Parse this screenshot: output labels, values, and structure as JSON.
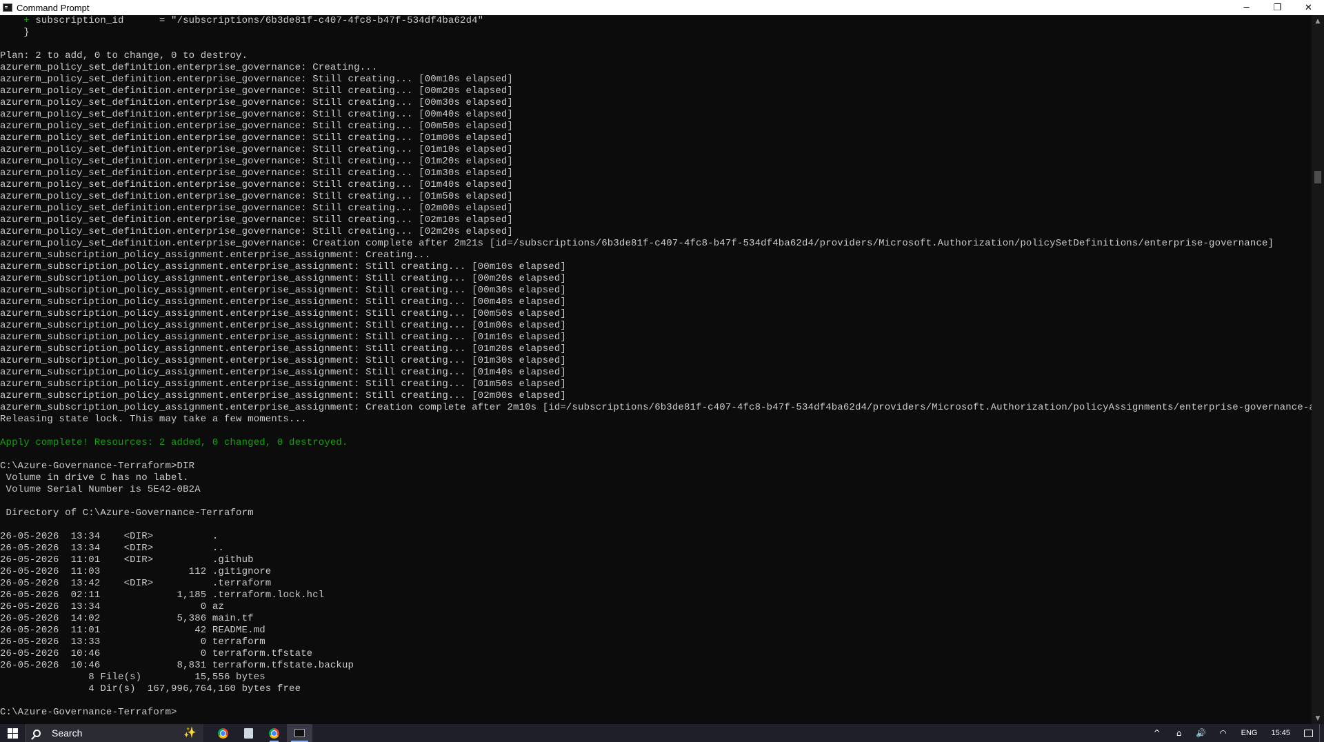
{
  "window": {
    "title": "Command Prompt",
    "minimize_glyph": "─",
    "maximize_glyph": "❐",
    "close_glyph": "✕"
  },
  "console": {
    "lines": [
      {
        "text": "    + subscription_id      = \"/subscriptions/6b3de81f-c407-4fc8-b47f-534df4ba62d4\"",
        "color": "plus"
      },
      {
        "text": "    }",
        "color": "default"
      },
      {
        "text": "",
        "color": "default"
      },
      {
        "text": "Plan: 2 to add, 0 to change, 0 to destroy.",
        "color": "default"
      },
      {
        "text": "azurerm_policy_set_definition.enterprise_governance: Creating...",
        "color": "default"
      },
      {
        "text": "azurerm_policy_set_definition.enterprise_governance: Still creating... [00m10s elapsed]",
        "color": "default"
      },
      {
        "text": "azurerm_policy_set_definition.enterprise_governance: Still creating... [00m20s elapsed]",
        "color": "default"
      },
      {
        "text": "azurerm_policy_set_definition.enterprise_governance: Still creating... [00m30s elapsed]",
        "color": "default"
      },
      {
        "text": "azurerm_policy_set_definition.enterprise_governance: Still creating... [00m40s elapsed]",
        "color": "default"
      },
      {
        "text": "azurerm_policy_set_definition.enterprise_governance: Still creating... [00m50s elapsed]",
        "color": "default"
      },
      {
        "text": "azurerm_policy_set_definition.enterprise_governance: Still creating... [01m00s elapsed]",
        "color": "default"
      },
      {
        "text": "azurerm_policy_set_definition.enterprise_governance: Still creating... [01m10s elapsed]",
        "color": "default"
      },
      {
        "text": "azurerm_policy_set_definition.enterprise_governance: Still creating... [01m20s elapsed]",
        "color": "default"
      },
      {
        "text": "azurerm_policy_set_definition.enterprise_governance: Still creating... [01m30s elapsed]",
        "color": "default"
      },
      {
        "text": "azurerm_policy_set_definition.enterprise_governance: Still creating... [01m40s elapsed]",
        "color": "default"
      },
      {
        "text": "azurerm_policy_set_definition.enterprise_governance: Still creating... [01m50s elapsed]",
        "color": "default"
      },
      {
        "text": "azurerm_policy_set_definition.enterprise_governance: Still creating... [02m00s elapsed]",
        "color": "default"
      },
      {
        "text": "azurerm_policy_set_definition.enterprise_governance: Still creating... [02m10s elapsed]",
        "color": "default"
      },
      {
        "text": "azurerm_policy_set_definition.enterprise_governance: Still creating... [02m20s elapsed]",
        "color": "default"
      },
      {
        "text": "azurerm_policy_set_definition.enterprise_governance: Creation complete after 2m21s [id=/subscriptions/6b3de81f-c407-4fc8-b47f-534df4ba62d4/providers/Microsoft.Authorization/policySetDefinitions/enterprise-governance]",
        "color": "default"
      },
      {
        "text": "azurerm_subscription_policy_assignment.enterprise_assignment: Creating...",
        "color": "default"
      },
      {
        "text": "azurerm_subscription_policy_assignment.enterprise_assignment: Still creating... [00m10s elapsed]",
        "color": "default"
      },
      {
        "text": "azurerm_subscription_policy_assignment.enterprise_assignment: Still creating... [00m20s elapsed]",
        "color": "default"
      },
      {
        "text": "azurerm_subscription_policy_assignment.enterprise_assignment: Still creating... [00m30s elapsed]",
        "color": "default"
      },
      {
        "text": "azurerm_subscription_policy_assignment.enterprise_assignment: Still creating... [00m40s elapsed]",
        "color": "default"
      },
      {
        "text": "azurerm_subscription_policy_assignment.enterprise_assignment: Still creating... [00m50s elapsed]",
        "color": "default"
      },
      {
        "text": "azurerm_subscription_policy_assignment.enterprise_assignment: Still creating... [01m00s elapsed]",
        "color": "default"
      },
      {
        "text": "azurerm_subscription_policy_assignment.enterprise_assignment: Still creating... [01m10s elapsed]",
        "color": "default"
      },
      {
        "text": "azurerm_subscription_policy_assignment.enterprise_assignment: Still creating... [01m20s elapsed]",
        "color": "default"
      },
      {
        "text": "azurerm_subscription_policy_assignment.enterprise_assignment: Still creating... [01m30s elapsed]",
        "color": "default"
      },
      {
        "text": "azurerm_subscription_policy_assignment.enterprise_assignment: Still creating... [01m40s elapsed]",
        "color": "default"
      },
      {
        "text": "azurerm_subscription_policy_assignment.enterprise_assignment: Still creating... [01m50s elapsed]",
        "color": "default"
      },
      {
        "text": "azurerm_subscription_policy_assignment.enterprise_assignment: Still creating... [02m00s elapsed]",
        "color": "default"
      },
      {
        "text": "azurerm_subscription_policy_assignment.enterprise_assignment: Creation complete after 2m10s [id=/subscriptions/6b3de81f-c407-4fc8-b47f-534df4ba62d4/providers/Microsoft.Authorization/policyAssignments/enterprise-governance-assignment]",
        "color": "default"
      },
      {
        "text": "Releasing state lock. This may take a few moments...",
        "color": "default"
      },
      {
        "text": "",
        "color": "default"
      },
      {
        "text": "Apply complete! Resources: 2 added, 0 changed, 0 destroyed.",
        "color": "green"
      },
      {
        "text": "",
        "color": "default"
      },
      {
        "text": "C:\\Azure-Governance-Terraform>DIR",
        "color": "default"
      },
      {
        "text": " Volume in drive C has no label.",
        "color": "default"
      },
      {
        "text": " Volume Serial Number is 5E42-0B2A",
        "color": "default"
      },
      {
        "text": "",
        "color": "default"
      },
      {
        "text": " Directory of C:\\Azure-Governance-Terraform",
        "color": "default"
      },
      {
        "text": "",
        "color": "default"
      },
      {
        "text": "26-05-2026  13:34    <DIR>          .",
        "color": "default"
      },
      {
        "text": "26-05-2026  13:34    <DIR>          ..",
        "color": "default"
      },
      {
        "text": "26-05-2026  11:01    <DIR>          .github",
        "color": "default"
      },
      {
        "text": "26-05-2026  11:03               112 .gitignore",
        "color": "default"
      },
      {
        "text": "26-05-2026  13:42    <DIR>          .terraform",
        "color": "default"
      },
      {
        "text": "26-05-2026  02:11             1,185 .terraform.lock.hcl",
        "color": "default"
      },
      {
        "text": "26-05-2026  13:34                 0 az",
        "color": "default"
      },
      {
        "text": "26-05-2026  14:02             5,386 main.tf",
        "color": "default"
      },
      {
        "text": "26-05-2026  11:01                42 README.md",
        "color": "default"
      },
      {
        "text": "26-05-2026  13:33                 0 terraform",
        "color": "default"
      },
      {
        "text": "26-05-2026  10:46                 0 terraform.tfstate",
        "color": "default"
      },
      {
        "text": "26-05-2026  10:46             8,831 terraform.tfstate.backup",
        "color": "default"
      },
      {
        "text": "               8 File(s)         15,556 bytes",
        "color": "default"
      },
      {
        "text": "               4 Dir(s)  167,996,764,160 bytes free",
        "color": "default"
      },
      {
        "text": "",
        "color": "default"
      },
      {
        "text": "C:\\Azure-Governance-Terraform>",
        "color": "default"
      }
    ],
    "colors": {
      "default": "#cccccc",
      "green": "#13a10e",
      "background": "#0c0c0c"
    }
  },
  "scrollbar": {
    "up_glyph": "▲",
    "down_glyph": "▼"
  },
  "taskbar": {
    "search_placeholder": "Search",
    "sparkle_glyph": "✨",
    "apps": [
      {
        "name": "chrome",
        "icon": "chrome-icon"
      },
      {
        "name": "file-explorer",
        "icon": "file-explorer-icon"
      },
      {
        "name": "chrome",
        "icon": "chrome-icon"
      },
      {
        "name": "command-prompt",
        "icon": "command-prompt-icon"
      }
    ],
    "tray": {
      "chevron_glyph": "^",
      "network_glyph": "⌂",
      "volume_glyph": "🔊",
      "wifi_glyph": "◠",
      "language": "ENG",
      "time": "15:45"
    }
  }
}
